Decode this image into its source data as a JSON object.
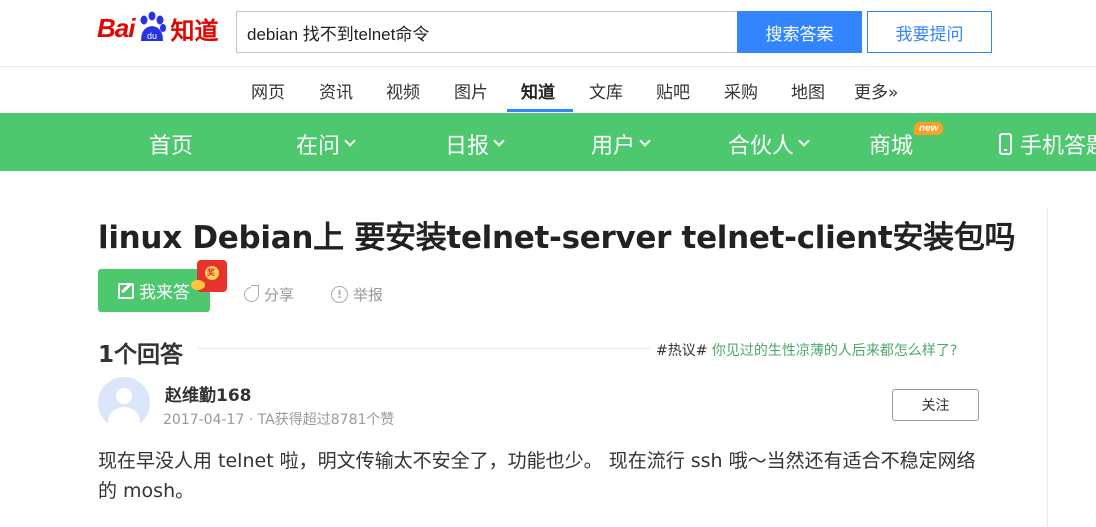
{
  "header": {
    "logo_bai": "Bai",
    "logo_du": "du",
    "logo_zhidao": "知道",
    "search_value": "debian 找不到telnet命令",
    "search_button": "搜索答案",
    "ask_button": "我要提问"
  },
  "channels": [
    {
      "label": "网页"
    },
    {
      "label": "资讯"
    },
    {
      "label": "视频"
    },
    {
      "label": "图片"
    },
    {
      "label": "知道",
      "active": true
    },
    {
      "label": "文库"
    },
    {
      "label": "贴吧"
    },
    {
      "label": "采购"
    },
    {
      "label": "地图"
    },
    {
      "label": "更多»"
    }
  ],
  "greennav": {
    "home": "首页",
    "ask": "在问",
    "daily": "日报",
    "user": "用户",
    "partner": "合伙人",
    "mall": "商城",
    "mall_badge": "new",
    "mobile": "手机答题"
  },
  "question": {
    "title": "linux Debian上 要安装telnet-server telnet-client安装包吗",
    "answer_button": "我来答",
    "redpacket_char": "奖",
    "share": "分享",
    "report": "举报",
    "report_glyph": "!"
  },
  "answers": {
    "count_label": "1个回答",
    "hot_tag": "#热议#",
    "hot_link": "你见过的生性凉薄的人后来都怎么样了?",
    "items": [
      {
        "user": "赵维勤168",
        "meta": "2017-04-17 · TA获得超过8781个赞",
        "follow": "关注",
        "content": "现在早没人用 telnet 啦，明文传输太不安全了，功能也少。 现在流行 ssh 哦～当然还有适合不稳定网络的 mosh。"
      }
    ]
  },
  "colors": {
    "brand_red": "#e10602",
    "brand_blue": "#3385ff",
    "nav_green": "#4dc86f",
    "hot_link_green": "#4ca96a"
  }
}
